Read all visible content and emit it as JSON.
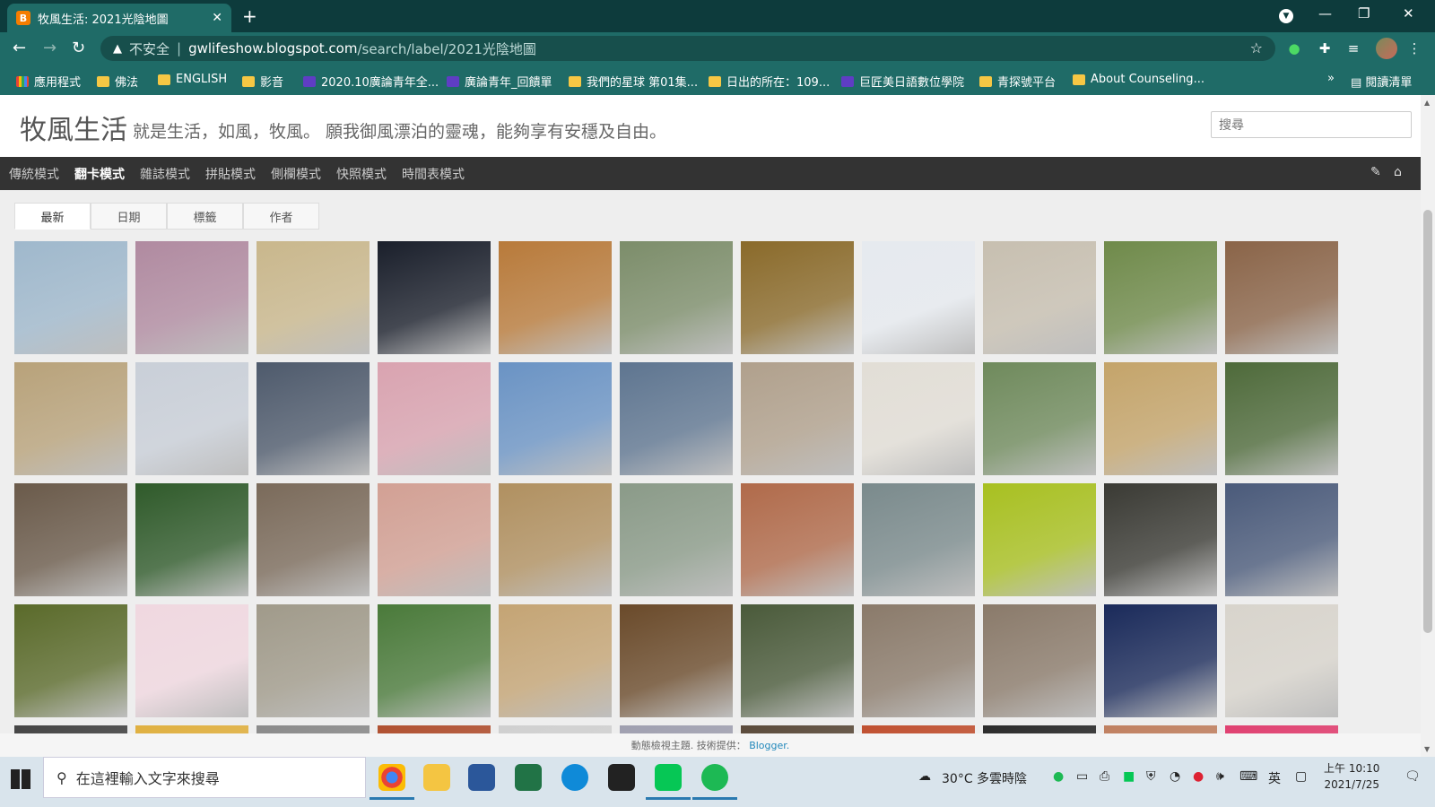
{
  "browser": {
    "tab_title": "牧風生活: 2021光陰地圖",
    "tab_favicon": "B",
    "newtab_label": "+",
    "insecure_label": "不安全",
    "url_host": "gwlifeshow.blogspot.com",
    "url_path": "/search/label/2021光陰地圖",
    "bookmarks": [
      {
        "label": "應用程式",
        "icon": "apps"
      },
      {
        "label": "佛法",
        "icon": "folder"
      },
      {
        "label": "ENGLISH",
        "icon": "folder"
      },
      {
        "label": "影音",
        "icon": "folder"
      },
      {
        "label": "2020.10廣論青年全...",
        "icon": "purple"
      },
      {
        "label": "廣論青年_回饋單",
        "icon": "purple"
      },
      {
        "label": "我們的星球 第01集...",
        "icon": "folder"
      },
      {
        "label": "日出的所在：109...",
        "icon": "folder"
      },
      {
        "label": "巨匠美日語數位學院",
        "icon": "purple"
      },
      {
        "label": "青探號平台",
        "icon": "folder"
      },
      {
        "label": "About Counseling...",
        "icon": "folder"
      }
    ],
    "more_bookmarks": "»",
    "reading_list": "閱讀清單"
  },
  "blog": {
    "title": "牧風生活",
    "description": "就是生活，如風，牧風。 願我御風漂泊的靈魂，能夠享有安穩及自由。",
    "search_placeholder": "搜尋",
    "views": [
      "傳統模式",
      "翻卡模式",
      "雜誌模式",
      "拼貼模式",
      "側欄模式",
      "快照模式",
      "時間表模式"
    ],
    "active_view": "翻卡模式",
    "sort_tabs": [
      "最新",
      "日期",
      "標籤",
      "作者"
    ],
    "active_sort": "最新",
    "footer_text": "動態檢視主題. 技術提供：",
    "footer_link": "Blogger."
  },
  "photos": [
    [
      "#9fb8cc",
      "#b08aa0",
      "#c9b78c",
      "#1a1f2b",
      "#b87a3a",
      "#7c8d6a",
      "#8a6a2a",
      "#e6eaef",
      "#c7bfb0",
      "#6f8a4a",
      "#8a6448"
    ],
    [
      "#b8a27a",
      "#c9cfd8",
      "#4e5a6c",
      "#d9a3b0",
      "#6a93c4",
      "#5e7590",
      "#b0a08c",
      "#e2ded6",
      "#6f8a5c",
      "#c4a46a",
      "#4e6a3a"
    ],
    [
      "#6a5a4a",
      "#2f5a2a",
      "#7a6a5a",
      "#d2a094",
      "#b09060",
      "#8a9a88",
      "#b06a4a",
      "#7a8a8c",
      "#a8c020",
      "#3a3a34",
      "#4a5a7a"
    ],
    [
      "#5a6a2a",
      "#f0d8e0",
      "#a09a8a",
      "#4a7a3a",
      "#c4a474",
      "#6a4a2a",
      "#4a5a3a",
      "#8a7a6a",
      "#8a7a6a",
      "#1a2a5a",
      "#d8d4cc"
    ],
    [
      "#444444",
      "#e0b040",
      "#8a8a8a",
      "#b05030",
      "#d0d0d0",
      "#a0a0b0",
      "#5a4a3a",
      "#c05030",
      "#2a2a2a",
      "#c08060",
      "#e04070"
    ]
  ],
  "taskbar": {
    "search_placeholder": "在這裡輸入文字來搜尋",
    "weather": "30°C 多雲時陰",
    "ime": "英",
    "time": "上午 10:10",
    "date": "2021/7/25"
  },
  "colors": {
    "browser_frame": "#0d3b3c",
    "browser_toolbar": "#1f6b67",
    "blog_navbar": "#333333",
    "link": "#2288bb"
  }
}
